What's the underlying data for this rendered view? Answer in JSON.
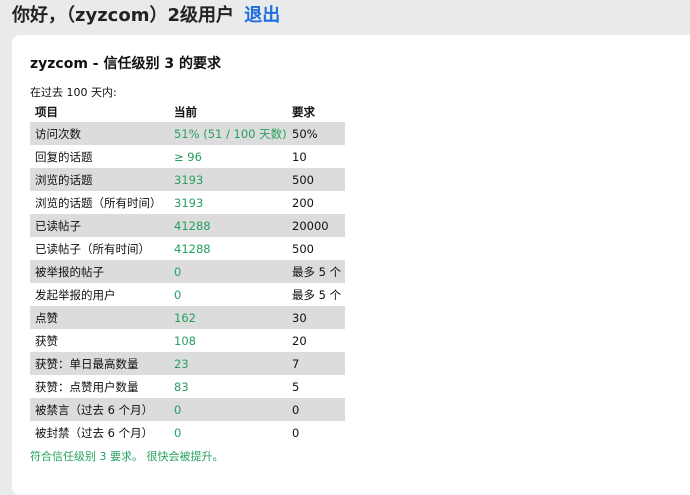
{
  "greeting": {
    "text": "你好，（zyzcom）2级用户",
    "logout_label": "退出"
  },
  "card": {
    "title": "zyzcom - 信任级别 3 的要求",
    "period": "在过去 100 天内:",
    "table": {
      "headers": [
        "项目",
        "当前",
        "要求"
      ],
      "rows": [
        {
          "item": "访问次数",
          "current": "51% (51 / 100 天数)",
          "required": "50%"
        },
        {
          "item": "回复的话题",
          "current": "≥ 96",
          "required": "10"
        },
        {
          "item": "浏览的话题",
          "current": "3193",
          "required": "500"
        },
        {
          "item": "浏览的话题（所有时间）",
          "current": "3193",
          "required": "200"
        },
        {
          "item": "已读帖子",
          "current": "41288",
          "required": "20000"
        },
        {
          "item": "已读帖子（所有时间）",
          "current": "41288",
          "required": "500"
        },
        {
          "item": "被举报的帖子",
          "current": "0",
          "required": "最多 5 个"
        },
        {
          "item": "发起举报的用户",
          "current": "0",
          "required": "最多 5 个"
        },
        {
          "item": "点赞",
          "current": "162",
          "required": "30"
        },
        {
          "item": "获赞",
          "current": "108",
          "required": "20"
        },
        {
          "item": "获赞：单日最高数量",
          "current": "23",
          "required": "7"
        },
        {
          "item": "获赞：点赞用户数量",
          "current": "83",
          "required": "5"
        },
        {
          "item": "被禁言（过去 6 个月）",
          "current": "0",
          "required": "0"
        },
        {
          "item": "被封禁（过去 6 个月）",
          "current": "0",
          "required": "0"
        }
      ]
    },
    "result": "符合信任级别 3 要求。 很快会被提升。"
  },
  "colors": {
    "met": "#27a060",
    "link": "#1f6fe0",
    "row_shade": "#dcdcdc",
    "page_bg": "#e9eaec"
  }
}
